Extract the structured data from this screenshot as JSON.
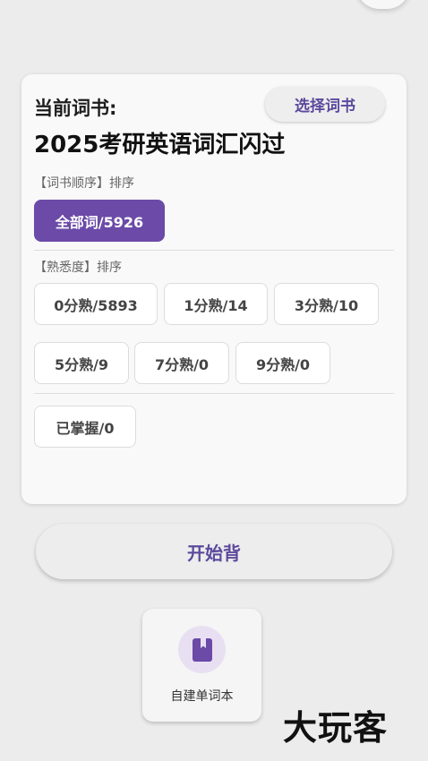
{
  "card": {
    "current_label": "当前词书:",
    "select_book_label": "选择词书",
    "book_title": "2025考研英语词汇闪过",
    "order_section_label": "【词书顺序】排序",
    "order_chips": [
      "全部词/5926"
    ],
    "familiarity_section_label": "【熟悉度】排序",
    "familiarity_chips": [
      "0分熟/5893",
      "1分熟/14",
      "3分熟/10",
      "5分熟/9",
      "7分熟/0",
      "9分熟/0"
    ],
    "mastered_chip": "已掌握/0"
  },
  "start_label": "开始背",
  "custom_wordbook": {
    "label": "自建单词本",
    "icon": "book-icon"
  },
  "watermark": "大玩客",
  "colors": {
    "accent": "#6b4aa8",
    "accent_text": "#5c4a9d",
    "icon_bg": "#e8e0f2"
  }
}
